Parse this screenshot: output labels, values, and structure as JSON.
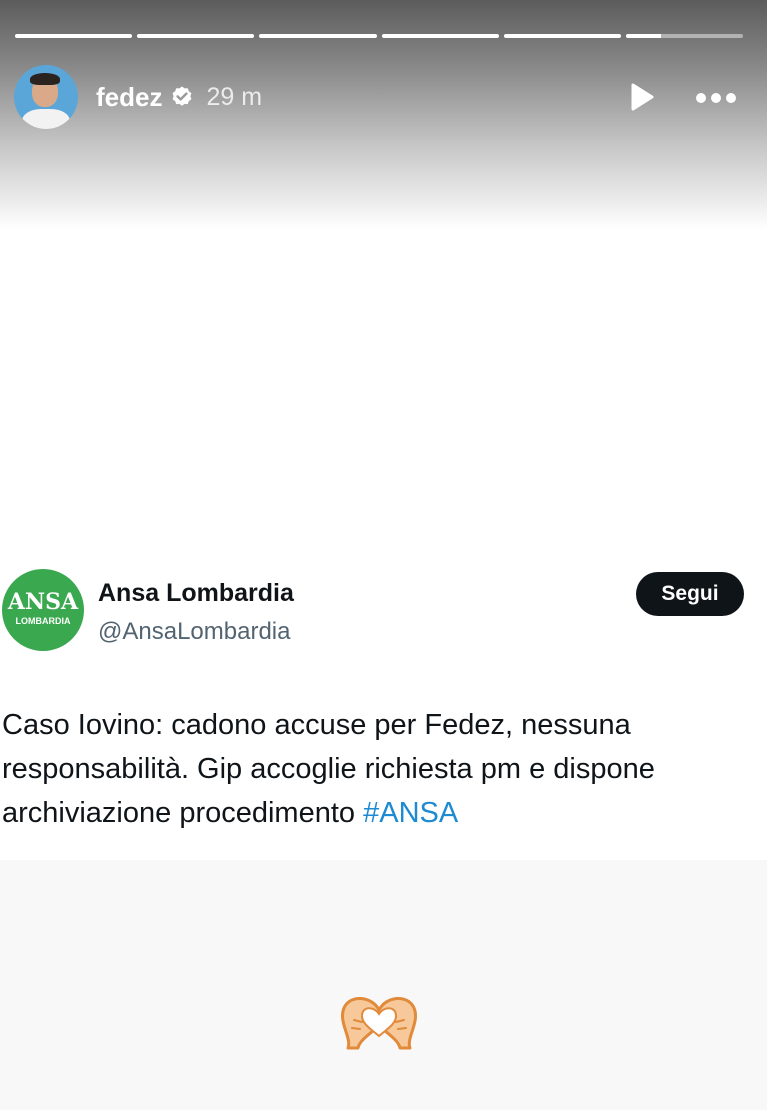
{
  "story": {
    "progress": [
      1,
      1,
      1,
      1,
      1,
      0.3
    ],
    "username": "fedez",
    "time_ago": "29 m",
    "verified_icon": "verified-badge-icon",
    "play_icon": "play-icon",
    "more_icon": "more-options-icon"
  },
  "tweet": {
    "logo_text": "ANSA",
    "logo_subtext": "LOMBARDIA",
    "logo_color": "#3aa84f",
    "account_name": "Ansa Lombardia",
    "handle": "@AnsaLombardia",
    "follow_label": "Segui",
    "text_line1": "Caso Iovino: cadono accuse per Fedez, nessuna",
    "text_line2": "responsabilità. Gip accoglie richiesta pm e dispone",
    "text_line3_prefix": "archiviazione procedimento ",
    "hashtag": "#ANSA",
    "hashtag_color": "#1d8bd1"
  },
  "sticker": {
    "icon": "heart-hands-emoji"
  }
}
